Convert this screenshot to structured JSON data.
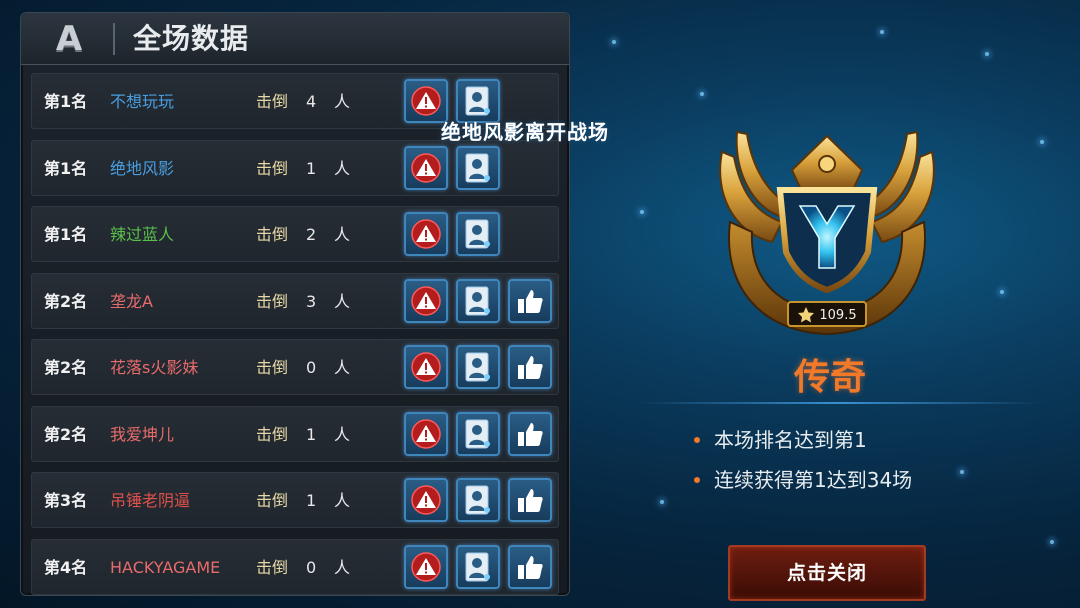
{
  "panel": {
    "grade": "A",
    "title": "全场数据"
  },
  "notification": "绝地风影离开战场",
  "players": [
    {
      "rank": "第1名",
      "name": "不想玩玩",
      "name_color": "#4a9ee0",
      "kill_label": "击倒",
      "kills": "4",
      "unit": "人",
      "has_like": false
    },
    {
      "rank": "第1名",
      "name": "绝地风影",
      "name_color": "#4a9ee0",
      "kill_label": "击倒",
      "kills": "1",
      "unit": "人",
      "has_like": false
    },
    {
      "rank": "第1名",
      "name": "辣过蓝人",
      "name_color": "#5bc04a",
      "kill_label": "击倒",
      "kills": "2",
      "unit": "人",
      "has_like": false
    },
    {
      "rank": "第2名",
      "name": "垄龙A",
      "name_color": "#e86b6b",
      "kill_label": "击倒",
      "kills": "3",
      "unit": "人",
      "has_like": true
    },
    {
      "rank": "第2名",
      "name": "花落s火影妹",
      "name_color": "#e86b6b",
      "kill_label": "击倒",
      "kills": "0",
      "unit": "人",
      "has_like": true
    },
    {
      "rank": "第2名",
      "name": "我爱坤儿",
      "name_color": "#e86b6b",
      "kill_label": "击倒",
      "kills": "1",
      "unit": "人",
      "has_like": true
    },
    {
      "rank": "第3名",
      "name": "吊锤老阴逼",
      "name_color": "#e0504a",
      "kill_label": "击倒",
      "kills": "1",
      "unit": "人",
      "has_like": true
    },
    {
      "rank": "第4名",
      "name": "HACKYAGAME",
      "name_color": "#e86b6b",
      "kill_label": "击倒",
      "kills": "0",
      "unit": "人",
      "has_like": true
    }
  ],
  "badge": {
    "score": "109.5",
    "rank_title": "传奇"
  },
  "achievements": [
    "本场排名达到第1",
    "连续获得第1达到34场"
  ],
  "close_button": "点击关闭",
  "icons": {
    "report": "warning-icon",
    "profile": "profile-icon",
    "like": "thumbs-up-icon"
  }
}
